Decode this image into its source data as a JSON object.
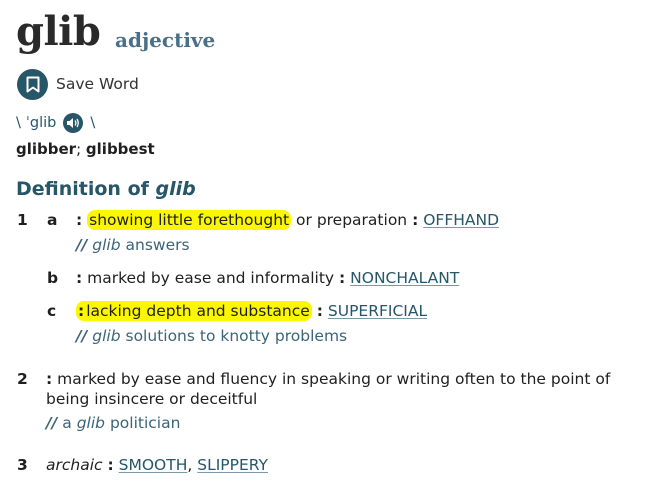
{
  "entry": {
    "headword": "glib",
    "part_of_speech": "adjective"
  },
  "save": {
    "label": "Save Word",
    "icon": "bookmark-icon"
  },
  "pronunciation": {
    "open": "\\",
    "text": "ˈglib",
    "close": "\\",
    "icon": "speaker-icon"
  },
  "inflections": {
    "first": "glibber",
    "separator": ";",
    "second": "glibbest"
  },
  "definition_heading": {
    "prefix": "Definition of",
    "word": "glib"
  },
  "senses": {
    "s1": {
      "number": "1",
      "a": {
        "letter": "a",
        "colon": ":",
        "highlighted_text": "showing little forethought",
        "rest_text": "or preparation",
        "xref_colon": ":",
        "xref": "OFFHAND",
        "example_slashes": "//",
        "example_word": "glib",
        "example_rest": "answers"
      },
      "b": {
        "letter": "b",
        "colon": ":",
        "text": "marked by ease and informality",
        "xref_colon": ":",
        "xref": "NONCHALANT"
      },
      "c": {
        "letter": "c",
        "colon": ":",
        "highlighted_text": "lacking depth and substance",
        "xref_colon": ":",
        "xref": "SUPERFICIAL",
        "example_slashes": "//",
        "example_word": "glib",
        "example_rest": "solutions to knotty problems"
      }
    },
    "s2": {
      "number": "2",
      "colon": ":",
      "text": "marked by ease and fluency in speaking or writing often to the point of being insincere or deceitful",
      "example_slashes": "//",
      "example_pre": "a",
      "example_word": "glib",
      "example_rest": "politician"
    },
    "s3": {
      "number": "3",
      "label": "archaic",
      "colon": ":",
      "xref1": "SMOOTH",
      "separator": ",",
      "xref2": "SLIPPERY"
    }
  },
  "colors": {
    "accent": "#265667",
    "pos": "#4a7088",
    "highlight": "#fbf700"
  }
}
